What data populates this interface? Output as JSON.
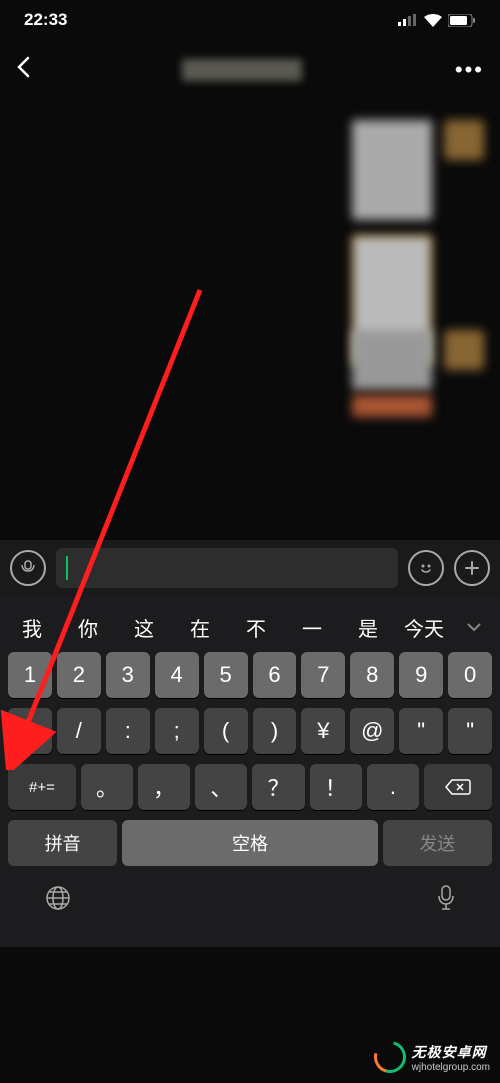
{
  "status": {
    "time": "22:33"
  },
  "input": {
    "voice_label": "voice",
    "emoji_label": "emoji",
    "plus_label": "more"
  },
  "suggestions": [
    "我",
    "你",
    "这",
    "在",
    "不",
    "一",
    "是",
    "今天"
  ],
  "row1": [
    "1",
    "2",
    "3",
    "4",
    "5",
    "6",
    "7",
    "8",
    "9",
    "0"
  ],
  "row2": [
    "-",
    "/",
    ":",
    ";",
    "(",
    ")",
    "¥",
    "@",
    "\"",
    "\""
  ],
  "row3": {
    "symbol": "#+=",
    "mids": [
      "。",
      "，",
      "、",
      "？",
      "！",
      "."
    ],
    "backspace": "⌫"
  },
  "bottom": {
    "pinyin": "拼音",
    "space": "空格",
    "send": "发送"
  },
  "watermark": {
    "main": "无极安卓网",
    "sub": "wjhotelgroup.com"
  }
}
